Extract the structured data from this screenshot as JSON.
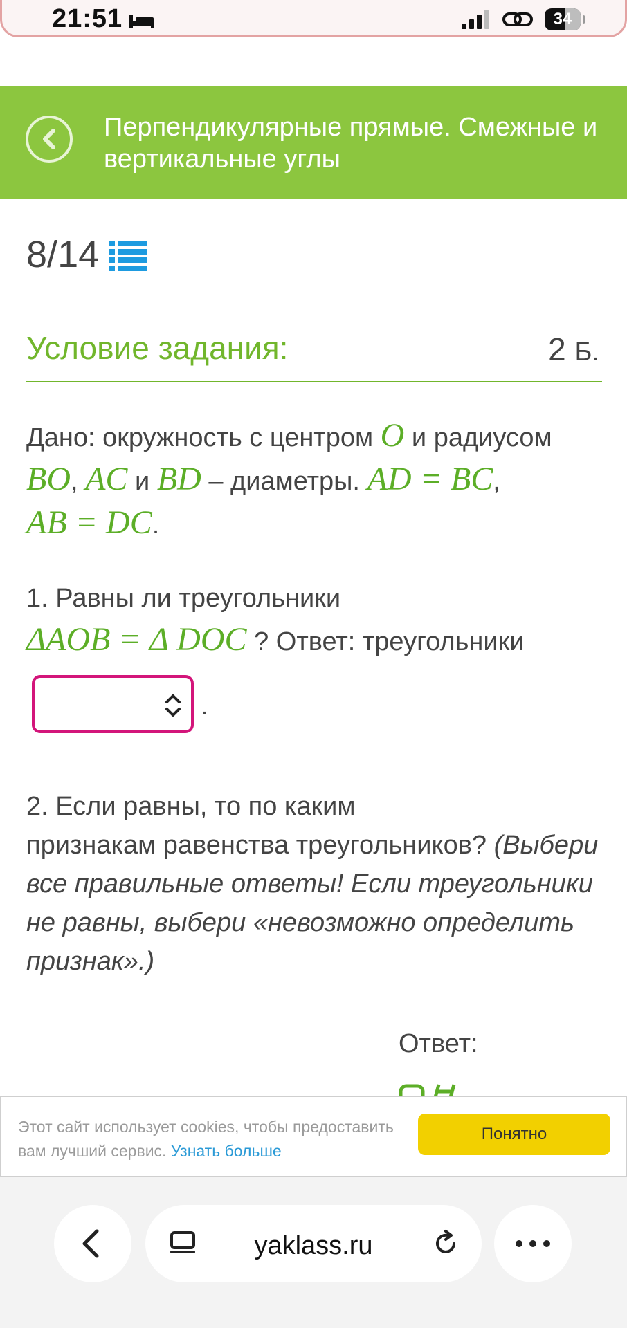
{
  "status_bar": {
    "time": "21:51",
    "battery": "34"
  },
  "header": {
    "title": "Перпендикулярные прямые. Смежные и вертикальные углы"
  },
  "progress": {
    "current": "8",
    "separator": "/",
    "total": "14"
  },
  "task": {
    "section_title": "Условие задания:",
    "points": "2",
    "points_unit": "Б.",
    "given_prefix": "Дано: окружность с центром",
    "center": "O",
    "radius_word": "и радиусом",
    "radius": "BO",
    "comma": ",",
    "diam1": "AC",
    "and_word": "и",
    "diam2": "BD",
    "diameters_word": "– диаметры.",
    "eq1": "AD = BC",
    "eq2": "AB = DC",
    "period": ".",
    "q1_text": "1. Равны ли треугольники",
    "q1_math": "ΔAOB = Δ DOC",
    "q1_answer": "? Ответ: треугольники",
    "select_value": "",
    "q2_text_1": "2. Если равны, то по каким",
    "q2_text_2": "признакам равенства треугольников?",
    "q2_hint": "(Выбери все правильные ответы! Если треугольники не равны, выбери «невозможно определить признак».)",
    "answer_label": "Ответ:"
  },
  "cookie": {
    "text": "Этот сайт использует cookies, чтобы предоставить вам лучший сервис.",
    "link": "Узнать больше",
    "button": "Понятно"
  },
  "browser": {
    "url": "yaklass.ru"
  },
  "colors": {
    "header_green": "#8cc63f",
    "accent_green": "#71b62c",
    "math_green": "#5cae27",
    "select_border": "#d3157a",
    "cookie_button": "#f2d000",
    "link_blue": "#2b9ad6"
  }
}
